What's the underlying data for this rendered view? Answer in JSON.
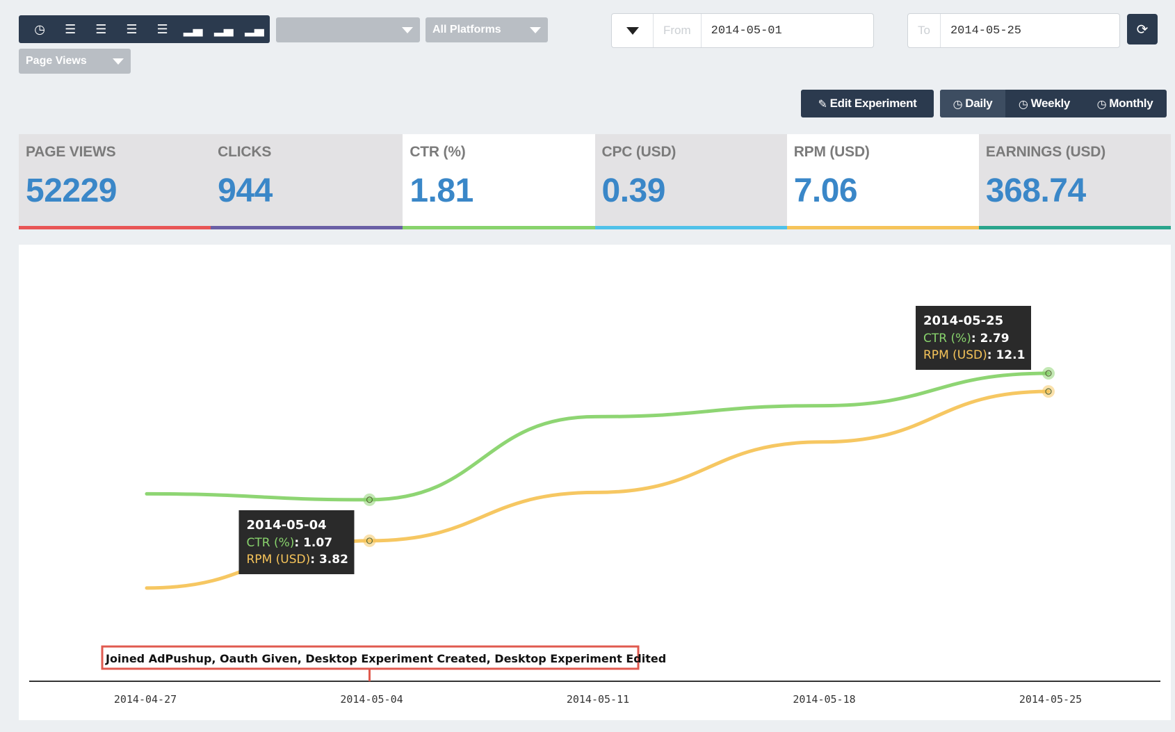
{
  "toolbar": {
    "icons": [
      "clock-icon",
      "list-icon",
      "list-icon",
      "list-icon",
      "list-icon",
      "bar-signal-icon",
      "bar-signal-icon",
      "bar-signal-icon"
    ],
    "site_select": "",
    "platform_select": "All Platforms",
    "metric_select": "Page Views",
    "from_label": "From",
    "from_value": "2014-05-01",
    "to_label": "To",
    "to_value": "2014-05-25"
  },
  "actions": {
    "edit_experiment": "Edit Experiment",
    "daily": "Daily",
    "weekly": "Weekly",
    "monthly": "Monthly",
    "active_period": "Daily"
  },
  "metrics": [
    {
      "name": "PAGE VIEWS",
      "value": "52229",
      "color": "#e85555",
      "selected": false
    },
    {
      "name": "CLICKS",
      "value": "944",
      "color": "#6a5fa5",
      "selected": false
    },
    {
      "name": "CTR (%)",
      "value": "1.81",
      "color": "#88d36c",
      "selected": true
    },
    {
      "name": "CPC (USD)",
      "value": "0.39",
      "color": "#4fc1e9",
      "selected": false
    },
    {
      "name": "RPM (USD)",
      "value": "7.06",
      "color": "#f6c45a",
      "selected": true
    },
    {
      "name": "EARNINGS (USD)",
      "value": "368.74",
      "color": "#2aa58c",
      "selected": false
    }
  ],
  "chart_data": {
    "type": "line",
    "x": [
      "2014-04-27",
      "2014-05-04",
      "2014-05-11",
      "2014-05-18",
      "2014-05-25"
    ],
    "x_ticks": [
      "2014-04-27",
      "2014-05-04",
      "2014-05-11",
      "2014-05-18",
      "2014-05-25"
    ],
    "series": [
      {
        "name": "CTR (%)",
        "color": "#88d36c",
        "values": [
          1.15,
          1.07,
          2.2,
          2.35,
          2.79
        ]
      },
      {
        "name": "RPM (USD)",
        "color": "#f6c45a",
        "values": [
          1.2,
          3.82,
          6.5,
          9.3,
          12.1
        ]
      }
    ],
    "tooltips": [
      {
        "date": "2014-05-04",
        "ctr_label": "CTR (%)",
        "ctr_value": "1.07",
        "rpm_label": "RPM (USD)",
        "rpm_value": "3.82"
      },
      {
        "date": "2014-05-25",
        "ctr_label": "CTR (%)",
        "ctr_value": "2.79",
        "rpm_label": "RPM (USD)",
        "rpm_value": "12.1"
      }
    ],
    "event_annotation": {
      "x": "2014-05-04",
      "text": "Joined AdPushup, Oauth Given, Desktop Experiment Created, Desktop Experiment Edited",
      "color": "#e05a4f"
    },
    "grid": false,
    "legend": "none"
  }
}
